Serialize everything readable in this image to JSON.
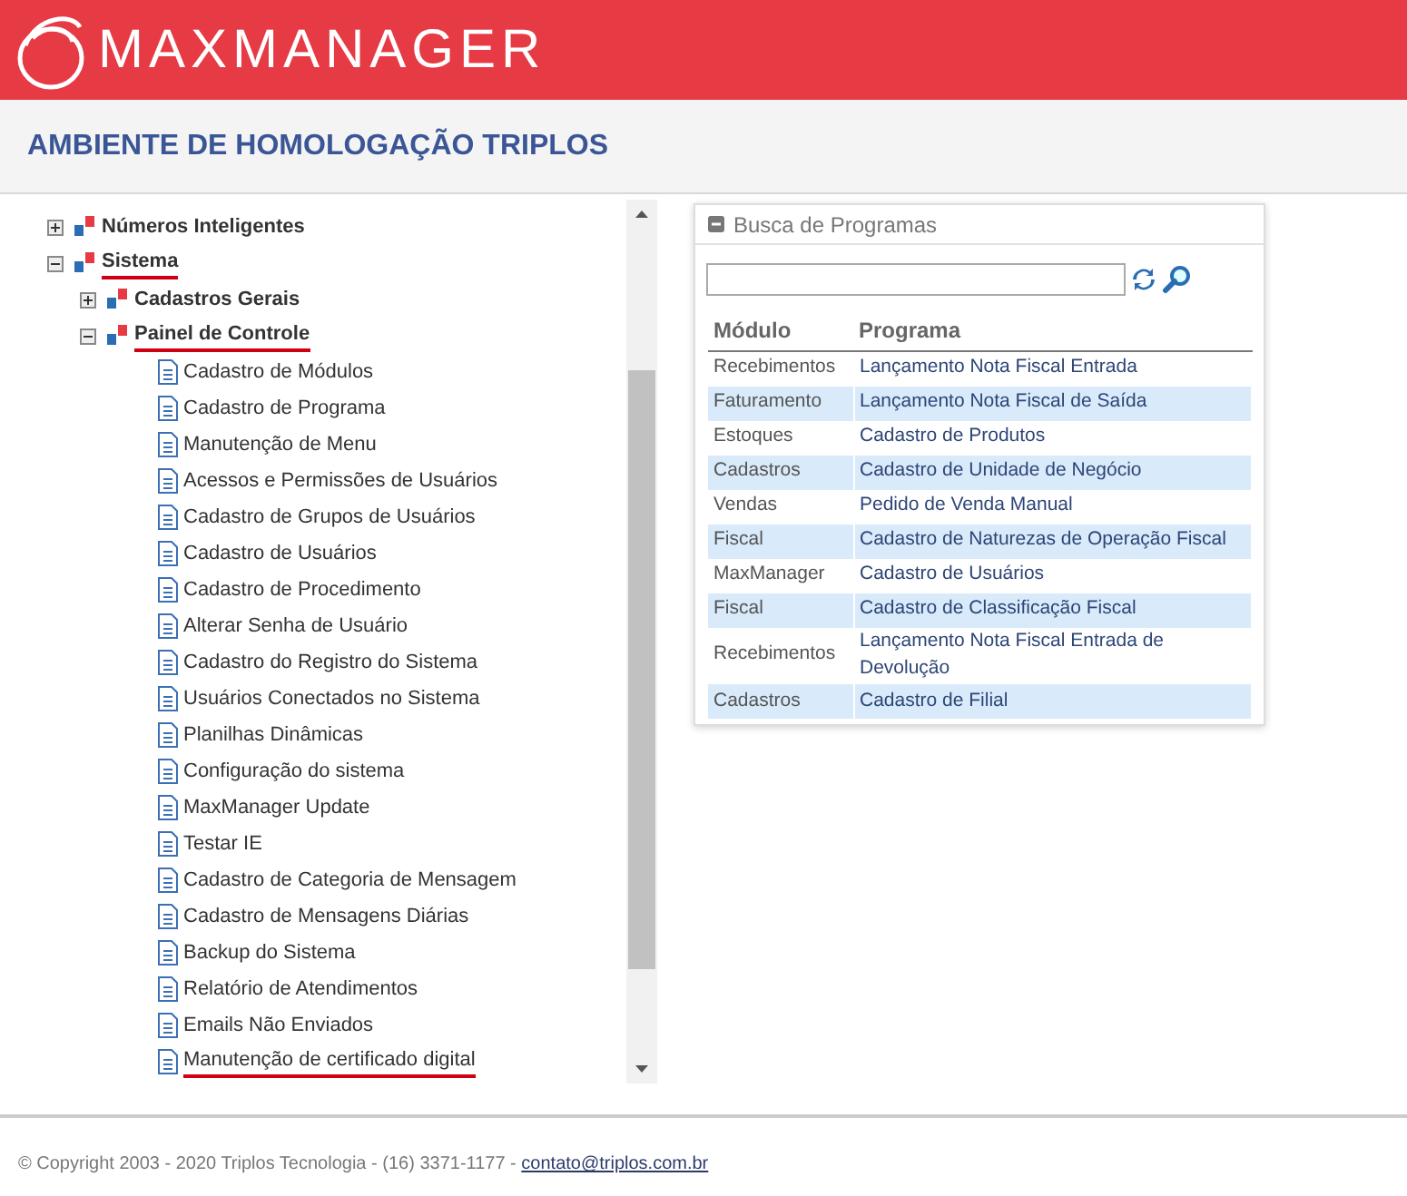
{
  "header": {
    "logo_text": "MAXMANAGER"
  },
  "title": "AMBIENTE DE HOMOLOGAÇÃO TRIPLOS",
  "tree": [
    {
      "label": "Números Inteligentes",
      "kind": "folder",
      "expanded": false,
      "marked": false
    },
    {
      "label": "Sistema",
      "kind": "folder",
      "expanded": true,
      "marked": true,
      "children": [
        {
          "label": "Cadastros Gerais",
          "kind": "folder",
          "expanded": false,
          "marked": false
        },
        {
          "label": "Painel de Controle",
          "kind": "folder",
          "expanded": true,
          "marked": true,
          "children": [
            {
              "label": "Cadastro de Módulos",
              "kind": "page",
              "marked": false
            },
            {
              "label": "Cadastro de Programa",
              "kind": "page",
              "marked": false
            },
            {
              "label": "Manutenção de Menu",
              "kind": "page",
              "marked": false
            },
            {
              "label": "Acessos e Permissões de Usuários",
              "kind": "page",
              "marked": false
            },
            {
              "label": "Cadastro de Grupos de Usuários",
              "kind": "page",
              "marked": false
            },
            {
              "label": "Cadastro de Usuários",
              "kind": "page",
              "marked": false
            },
            {
              "label": "Cadastro de Procedimento",
              "kind": "page",
              "marked": false
            },
            {
              "label": "Alterar Senha de Usuário",
              "kind": "page",
              "marked": false
            },
            {
              "label": "Cadastro do Registro do Sistema",
              "kind": "page",
              "marked": false
            },
            {
              "label": "Usuários Conectados no Sistema",
              "kind": "page",
              "marked": false
            },
            {
              "label": "Planilhas Dinâmicas",
              "kind": "page",
              "marked": false
            },
            {
              "label": "Configuração do sistema",
              "kind": "page",
              "marked": false
            },
            {
              "label": "MaxManager Update",
              "kind": "page",
              "marked": false
            },
            {
              "label": "Testar IE",
              "kind": "page",
              "marked": false
            },
            {
              "label": "Cadastro de Categoria de Mensagem",
              "kind": "page",
              "marked": false
            },
            {
              "label": "Cadastro de Mensagens Diárias",
              "kind": "page",
              "marked": false
            },
            {
              "label": "Backup do Sistema",
              "kind": "page",
              "marked": false
            },
            {
              "label": "Relatório de Atendimentos",
              "kind": "page",
              "marked": false
            },
            {
              "label": "Emails Não Enviados",
              "kind": "page",
              "marked": false
            },
            {
              "label": "Manutenção de certificado digital",
              "kind": "page",
              "marked": true
            }
          ]
        }
      ]
    }
  ],
  "search_panel": {
    "title": "Busca de Programas",
    "expanded": true,
    "table": {
      "columns": [
        "Módulo",
        "Programa"
      ],
      "rows": [
        [
          "Recebimentos",
          "Lançamento Nota Fiscal Entrada"
        ],
        [
          "Faturamento",
          "Lançamento Nota Fiscal de Saída"
        ],
        [
          "Estoques",
          "Cadastro de Produtos"
        ],
        [
          "Cadastros",
          "Cadastro de Unidade de Negócio"
        ],
        [
          "Vendas",
          "Pedido de Venda Manual"
        ],
        [
          "Fiscal",
          "Cadastro de Naturezas de Operação Fiscal"
        ],
        [
          "MaxManager",
          "Cadastro de Usuários"
        ],
        [
          "Fiscal",
          "Cadastro de Classificação Fiscal"
        ],
        [
          "Recebimentos",
          "Lançamento Nota Fiscal Entrada de Devolução"
        ],
        [
          "Cadastros",
          "Cadastro de Filial"
        ]
      ]
    }
  },
  "footer": {
    "text": "© Copyright 2003 - 2020 Triplos Tecnologia - (16) 3371-1177 - ",
    "email": "contato@triplos.com.br"
  }
}
